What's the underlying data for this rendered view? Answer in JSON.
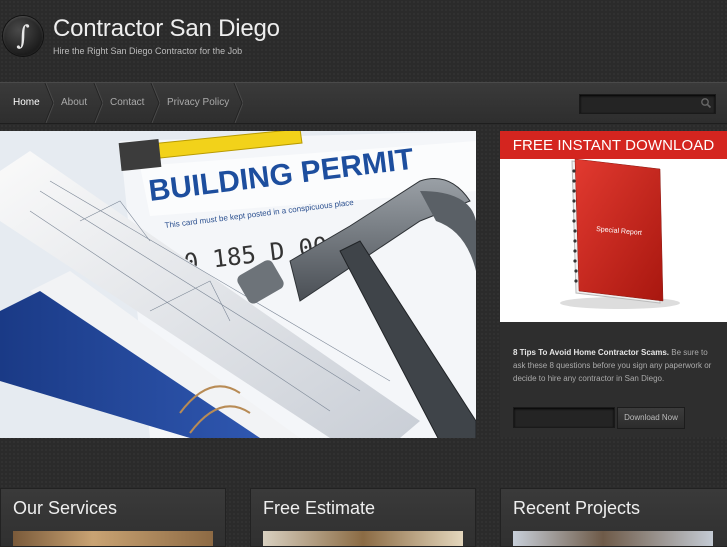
{
  "header": {
    "logo_glyph": "∫",
    "title": "Contractor San Diego",
    "tagline": "Hire the Right San Diego Contractor for the Job"
  },
  "nav": {
    "items": [
      {
        "label": "Home",
        "active": true
      },
      {
        "label": "About",
        "active": false
      },
      {
        "label": "Contact",
        "active": false
      },
      {
        "label": "Privacy Policy",
        "active": false
      }
    ],
    "search_placeholder": ""
  },
  "hero": {
    "permit_text": "BUILDING PERMIT",
    "card_line": "This card must be kept posted in a conspicuous place",
    "permit_number": "0 185 D 00 SR"
  },
  "promo": {
    "banner": "FREE INSTANT DOWNLOAD",
    "book_title": "Special Report",
    "lead": "8 Tips To Avoid Home Contractor Scams.",
    "body": " Be sure to ask these 8 questions before you sign any paperwork or decide to hire any contractor in San Diego.",
    "email_placeholder": "",
    "button": "Download Now"
  },
  "cards": [
    {
      "title": "Our Services"
    },
    {
      "title": "Free Estimate"
    },
    {
      "title": "Recent Projects"
    }
  ],
  "colors": {
    "accent_red": "#d4251f",
    "background": "#2b2b2b"
  }
}
